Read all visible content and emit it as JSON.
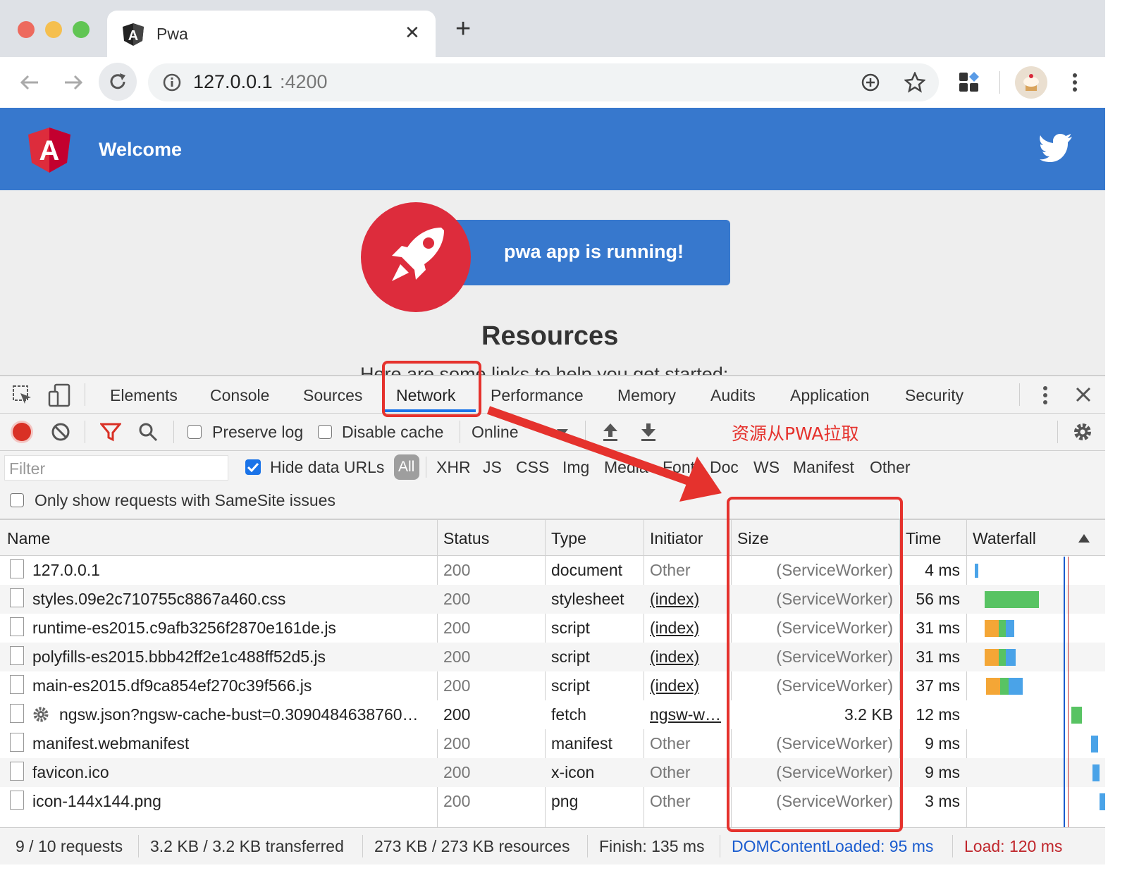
{
  "browser": {
    "tab_title": "Pwa",
    "url_host": "127.0.0.1",
    "url_port": ":4200",
    "new_tab_label": "+",
    "close_tab_label": "✕"
  },
  "app": {
    "header_title": "Welcome",
    "banner_text": "pwa app is running!",
    "resources_heading": "Resources",
    "resources_subtitle": "Here are some links to help you get started:"
  },
  "devtools": {
    "tabs": [
      "Elements",
      "Console",
      "Sources",
      "Network",
      "Performance",
      "Memory",
      "Audits",
      "Application",
      "Security"
    ],
    "active_tab": "Network",
    "controls": {
      "preserve_log": "Preserve log",
      "disable_cache": "Disable cache",
      "throttle": "Online",
      "annotation": "资源从PWA拉取"
    },
    "filter": {
      "placeholder": "Filter",
      "hide_data_urls": "Hide data URLs",
      "types": [
        "All",
        "XHR",
        "JS",
        "CSS",
        "Img",
        "Media",
        "Font",
        "Doc",
        "WS",
        "Manifest",
        "Other"
      ],
      "samesite": "Only show requests with SameSite issues"
    },
    "columns": [
      "Name",
      "Status",
      "Type",
      "Initiator",
      "Size",
      "Time",
      "Waterfall"
    ],
    "rows": [
      {
        "name": "127.0.0.1",
        "status": "200",
        "type": "document",
        "initiator": "Other",
        "size": "(ServiceWorker)",
        "time": "4 ms"
      },
      {
        "name": "styles.09e2c710755c8867a460.css",
        "status": "200",
        "type": "stylesheet",
        "initiator": "(index)",
        "size": "(ServiceWorker)",
        "time": "56 ms"
      },
      {
        "name": "runtime-es2015.c9afb3256f2870e161de.js",
        "status": "200",
        "type": "script",
        "initiator": "(index)",
        "size": "(ServiceWorker)",
        "time": "31 ms"
      },
      {
        "name": "polyfills-es2015.bbb42ff2e1c488ff52d5.js",
        "status": "200",
        "type": "script",
        "initiator": "(index)",
        "size": "(ServiceWorker)",
        "time": "31 ms"
      },
      {
        "name": "main-es2015.df9ca854ef270c39f566.js",
        "status": "200",
        "type": "script",
        "initiator": "(index)",
        "size": "(ServiceWorker)",
        "time": "37 ms"
      },
      {
        "name": "ngsw.json?ngsw-cache-bust=0.3090484638760…",
        "status": "200",
        "type": "fetch",
        "initiator": "ngsw-w…",
        "size": "3.2 KB",
        "time": "12 ms"
      },
      {
        "name": "manifest.webmanifest",
        "status": "200",
        "type": "manifest",
        "initiator": "Other",
        "size": "(ServiceWorker)",
        "time": "9 ms"
      },
      {
        "name": "favicon.ico",
        "status": "200",
        "type": "x-icon",
        "initiator": "Other",
        "size": "(ServiceWorker)",
        "time": "9 ms"
      },
      {
        "name": "icon-144x144.png",
        "status": "200",
        "type": "png",
        "initiator": "Other",
        "size": "(ServiceWorker)",
        "time": "3 ms"
      }
    ],
    "summary": {
      "requests": "9 / 10 requests",
      "transferred": "3.2 KB / 3.2 KB transferred",
      "resources": "273 KB / 273 KB resources",
      "finish": "Finish: 135 ms",
      "dom_loaded": "DOMContentLoaded: 95 ms",
      "load": "Load: 120 ms"
    }
  },
  "colors": {
    "header_blue": "#3778cd",
    "angular_red": "#dd2c3c",
    "annotation_red": "#e5322d",
    "dom_blue": "#1a5ccf",
    "load_red": "#c0262c"
  }
}
